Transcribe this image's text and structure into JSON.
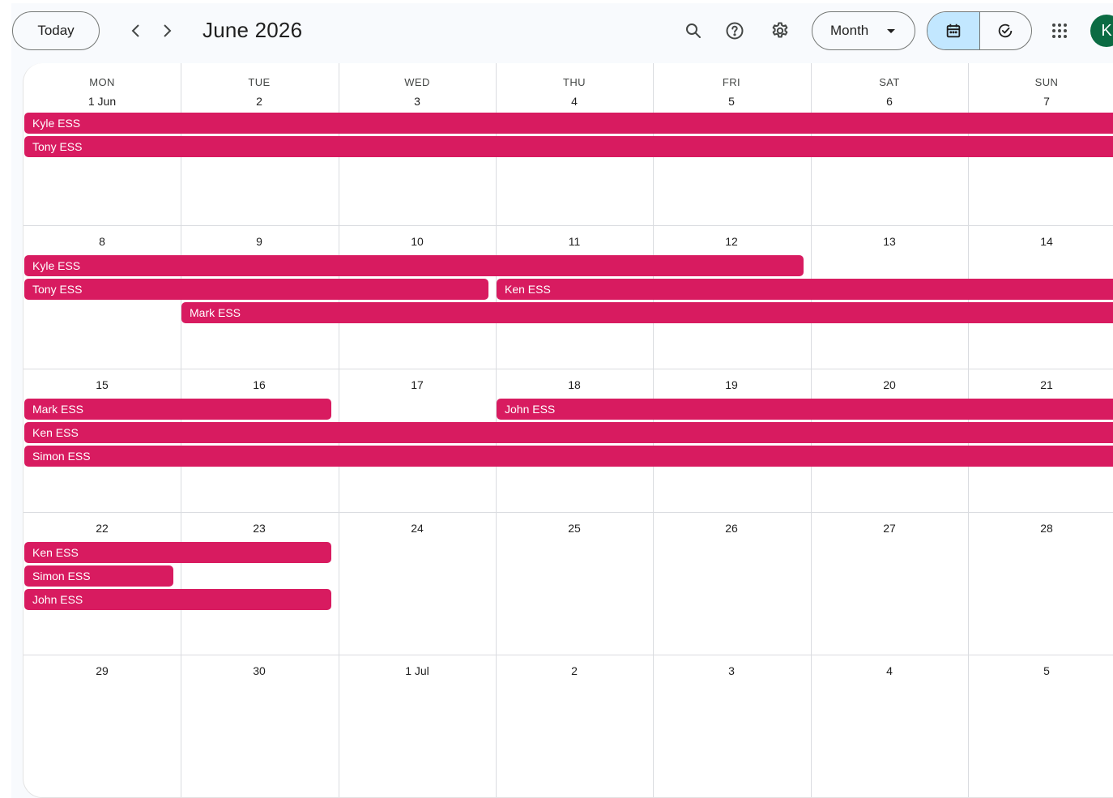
{
  "header": {
    "today_label": "Today",
    "month_title": "June 2026",
    "view_label": "Month",
    "avatar_initial": "K"
  },
  "icons": {
    "prev": "chevron-left-icon",
    "next": "chevron-right-icon",
    "search": "search-icon",
    "help": "help-icon",
    "settings": "gear-icon",
    "calendar": "calendar-icon",
    "tasks": "check-circle-icon",
    "apps": "apps-grid-icon"
  },
  "colors": {
    "event": "#d81b60",
    "avatar": "#0b6b43",
    "active_view": "#c2e7ff"
  },
  "weekdays": [
    "MON",
    "TUE",
    "WED",
    "THU",
    "FRI",
    "SAT",
    "SUN"
  ],
  "weeks": [
    {
      "dates": [
        "1 Jun",
        "2",
        "3",
        "4",
        "5",
        "6",
        "7"
      ],
      "events": [
        {
          "title": "Kyle ESS",
          "start": 0,
          "span": 7
        },
        {
          "title": "Tony ESS",
          "start": 0,
          "span": 7
        }
      ]
    },
    {
      "dates": [
        "8",
        "9",
        "10",
        "11",
        "12",
        "13",
        "14"
      ],
      "events": [
        {
          "title": "Kyle ESS",
          "start": 0,
          "span": 5
        },
        {
          "title": "Tony ESS",
          "start": 0,
          "span": 3
        },
        {
          "title": "Ken ESS",
          "start": 3,
          "span": 4
        },
        {
          "title": "Mark ESS",
          "start": 1,
          "span": 6
        }
      ]
    },
    {
      "dates": [
        "15",
        "16",
        "17",
        "18",
        "19",
        "20",
        "21"
      ],
      "events": [
        {
          "title": "Mark ESS",
          "start": 0,
          "span": 2
        },
        {
          "title": "John ESS",
          "start": 3,
          "span": 4
        },
        {
          "title": "Ken ESS",
          "start": 0,
          "span": 7
        },
        {
          "title": "Simon ESS",
          "start": 0,
          "span": 7
        }
      ]
    },
    {
      "dates": [
        "22",
        "23",
        "24",
        "25",
        "26",
        "27",
        "28"
      ],
      "events": [
        {
          "title": "Ken ESS",
          "start": 0,
          "span": 2
        },
        {
          "title": "Simon ESS",
          "start": 0,
          "span": 1
        },
        {
          "title": "John ESS",
          "start": 0,
          "span": 2
        }
      ]
    },
    {
      "dates": [
        "29",
        "30",
        "1 Jul",
        "2",
        "3",
        "4",
        "5"
      ],
      "events": []
    }
  ]
}
